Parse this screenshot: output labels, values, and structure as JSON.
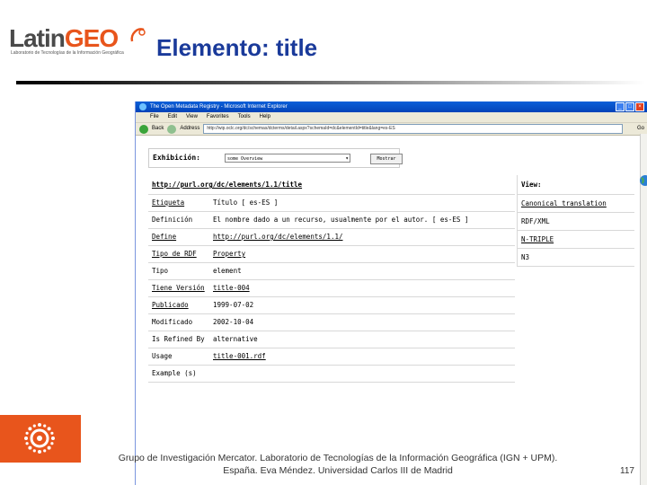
{
  "slide": {
    "logo_text_a": "Latin",
    "logo_text_b": "GEO",
    "logo_tagline": "Laboratorio de Tecnologías de la Información Geográfica",
    "title": "Elemento: title",
    "footer_line1": "Grupo de Investigación Mercator. Laboratorio de Tecnologías de la Información Geográfica (IGN + UPM).",
    "footer_line2": "España. Eva Méndez. Universidad Carlos III de Madrid",
    "page_number": "117"
  },
  "browser": {
    "window_title": "The Open Metadata Registry - Microsoft Internet Explorer",
    "menu": [
      "File",
      "Edit",
      "View",
      "Favorites",
      "Tools",
      "Help"
    ],
    "back_label": "Back",
    "address_label": "Address",
    "address_value": "http://wip.oclc.org/dc/schemas/dcterms/detail.aspx?schemaId=dc&elementId=title&lang=es-ES",
    "go_label": "Go",
    "exhibition_label": "Exhibición:",
    "exhibition_selected": "some Overview",
    "exhibition_button": "Mostrar",
    "element_uri": "http://purl.org/dc/elements/1.1/title",
    "rows": [
      {
        "key": "Etiqueta",
        "value": "Título [ es-ES ]"
      },
      {
        "key": "Definición",
        "value": "El nombre dado a un recurso, usualmente por el autor. [ es-ES ]"
      },
      {
        "key": "Define",
        "value": "http://purl.org/dc/elements/1.1/"
      },
      {
        "key": "Tipo de RDF",
        "value": "Property"
      },
      {
        "key": "Tipo",
        "value": "element"
      },
      {
        "key": "Tiene Versión",
        "value": "title-004"
      },
      {
        "key": "Publicado",
        "value": "1999-07-02"
      },
      {
        "key": "Modificado",
        "value": "2002-10-04"
      },
      {
        "key": "Is Refined By",
        "value": "alternative"
      },
      {
        "key": "Usage",
        "value": "title-001.rdf"
      },
      {
        "key": "Example (s)",
        "value": ""
      }
    ],
    "view": {
      "header": "View:",
      "items": [
        "Canonical translation",
        "RDF/XML",
        "N-TRIPLE",
        "N3"
      ]
    }
  }
}
